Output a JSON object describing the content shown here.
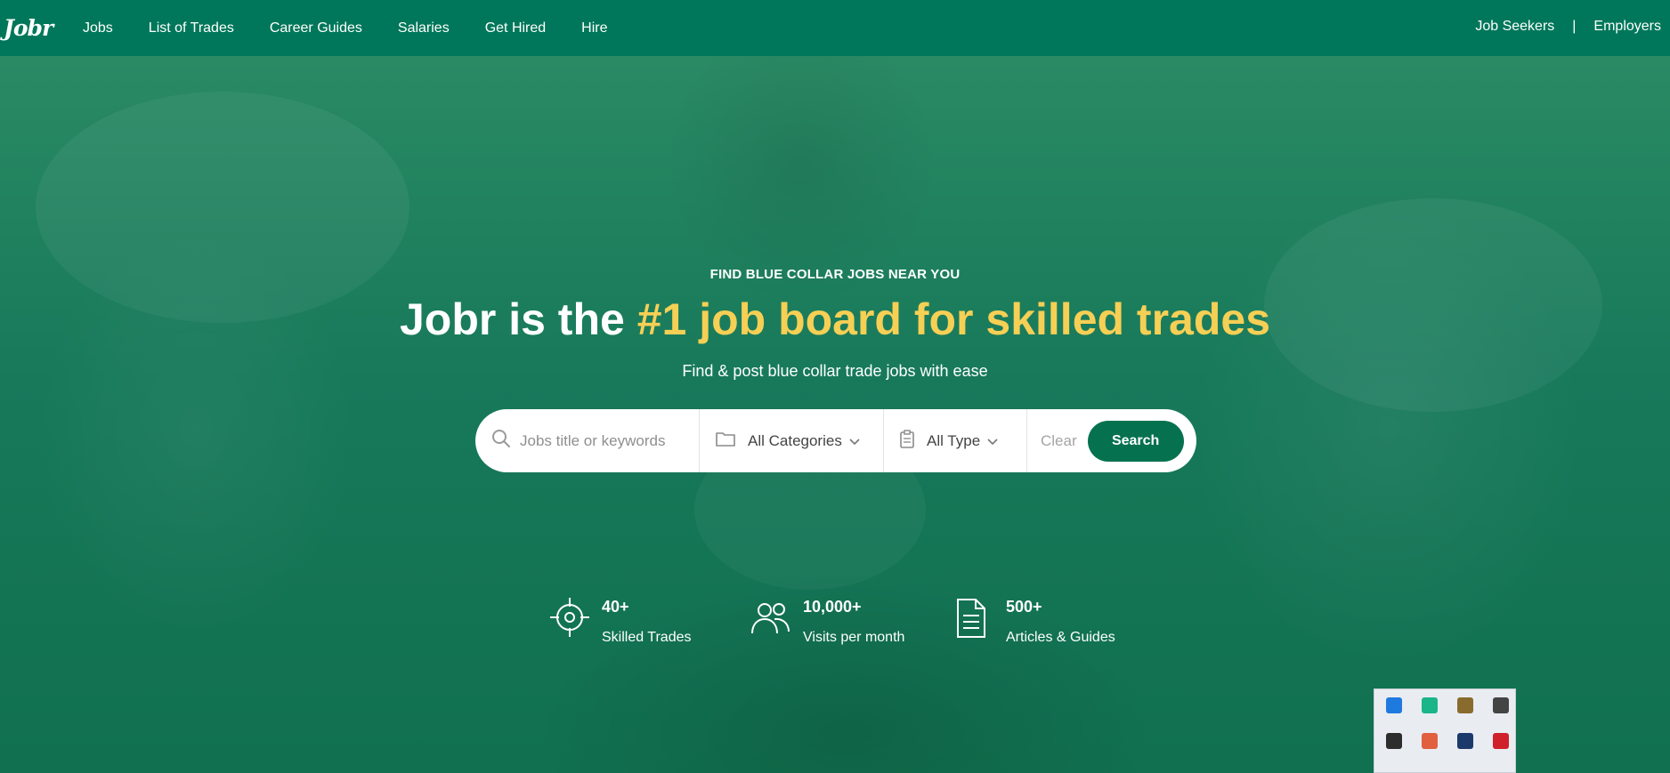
{
  "nav": {
    "logo": "Jobr",
    "links": [
      "Jobs",
      "List of Trades",
      "Career Guides",
      "Salaries",
      "Get Hired",
      "Hire"
    ],
    "right_links": [
      "Job Seekers",
      "Employers"
    ],
    "separator": "|"
  },
  "hero": {
    "eyebrow": "FIND BLUE COLLAR JOBS NEAR YOU",
    "headline_plain": "Jobr is the ",
    "headline_highlight": "#1 job board for skilled trades",
    "subline": "Find & post blue collar trade jobs with ease"
  },
  "search": {
    "placeholder": "Jobs title or keywords",
    "category": "All Categories",
    "type": "All Type",
    "clear": "Clear",
    "button": "Search"
  },
  "stats": [
    {
      "value": "40+",
      "label": "Skilled Trades",
      "icon": "target-icon"
    },
    {
      "value": "10,000+",
      "label": "Visits per month",
      "icon": "users-icon"
    },
    {
      "value": "500+",
      "label": "Articles & Guides",
      "icon": "document-icon"
    }
  ],
  "colors": {
    "brand_green": "#00775a",
    "button_green": "#05714f",
    "highlight_yellow": "#f6cf55"
  },
  "tray_icons": [
    "bluetooth-icon",
    "wallet-icon",
    "grid-app-icon",
    "shield-icon",
    "nvidia-icon",
    "cloud-icon",
    "steam-icon",
    "amd-icon"
  ]
}
